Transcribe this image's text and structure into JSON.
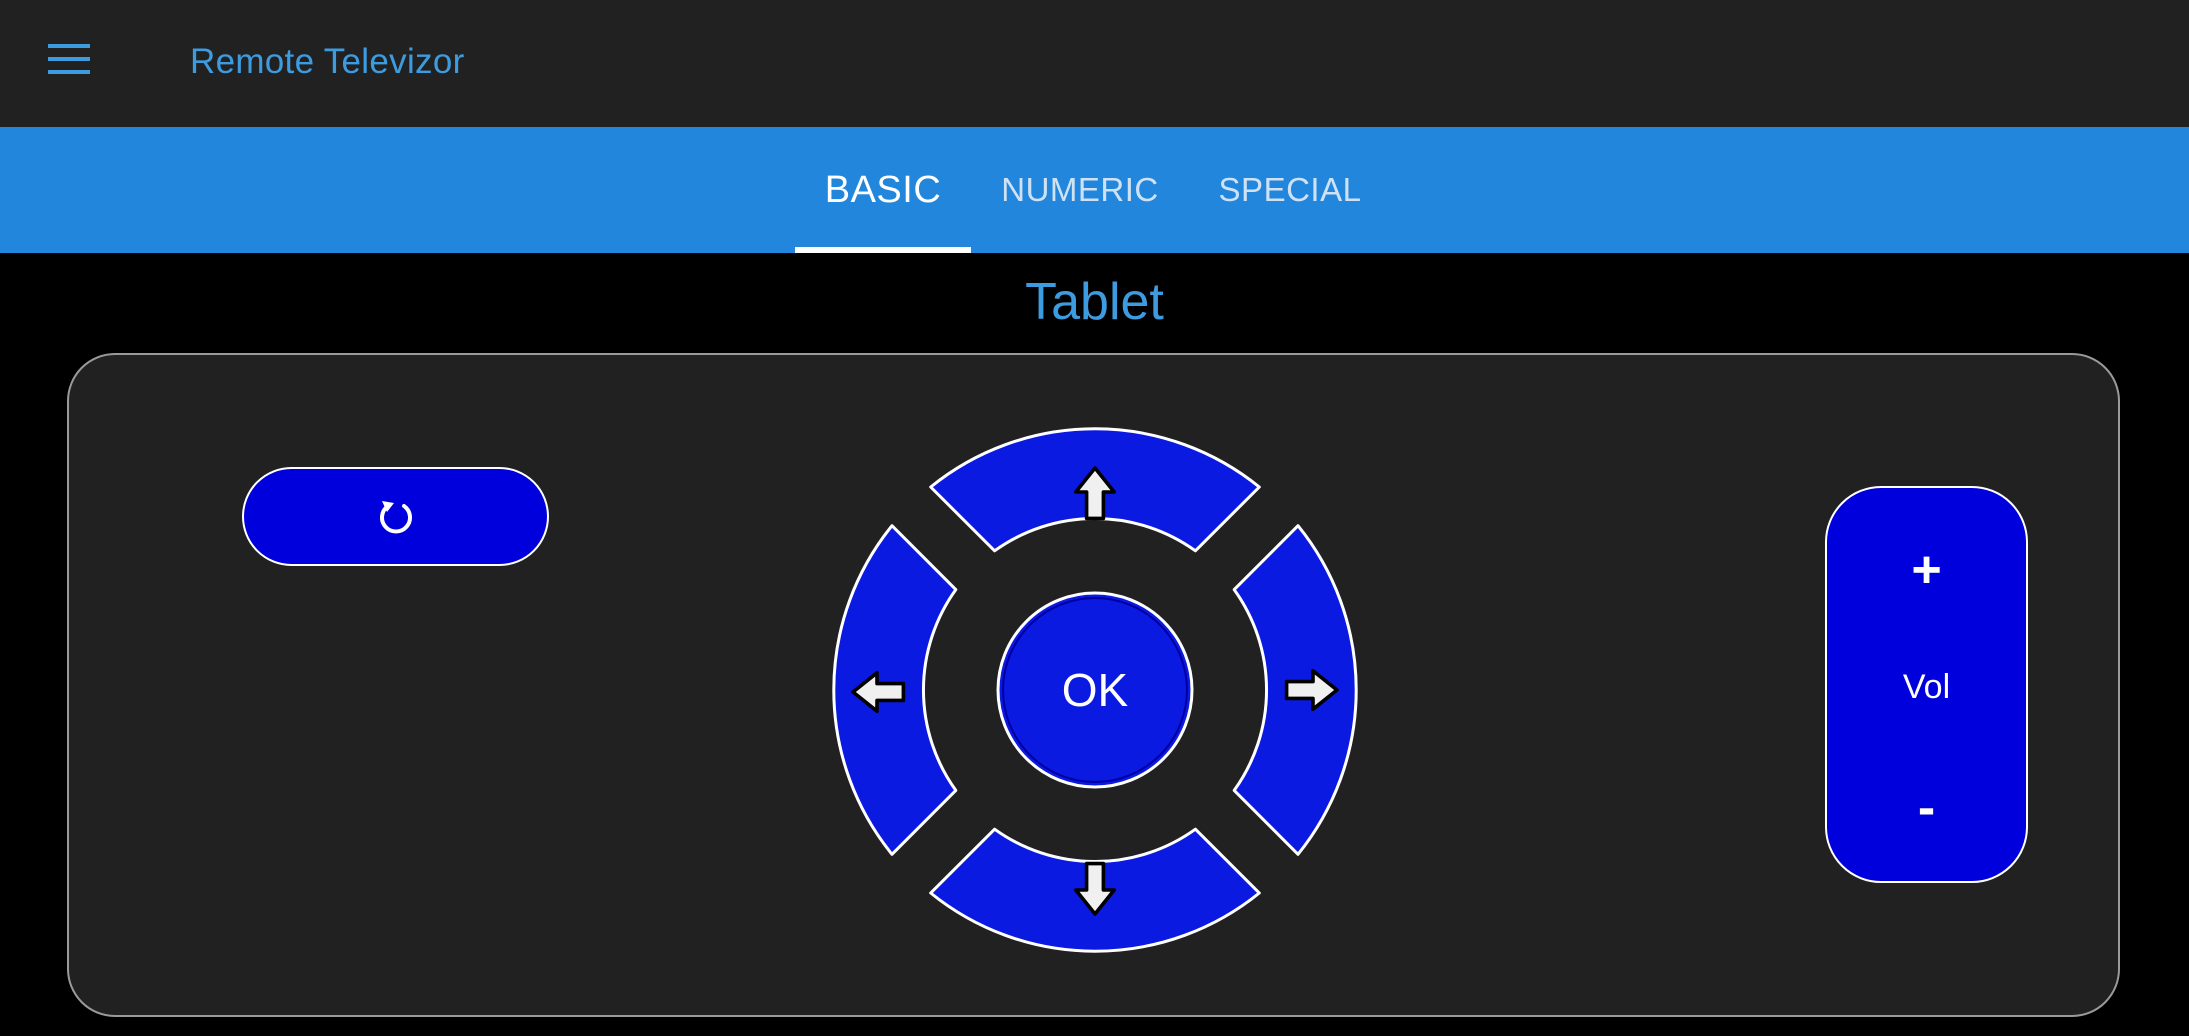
{
  "app": {
    "title": "Remote Televizor"
  },
  "tabs": [
    {
      "label": "BASIC",
      "active": true
    },
    {
      "label": "NUMERIC",
      "active": false
    },
    {
      "label": "SPECIAL",
      "active": false
    }
  ],
  "device": {
    "name": "Tablet"
  },
  "remote": {
    "back_icon": "refresh-icon",
    "dpad": {
      "ok_label": "OK",
      "up_icon": "arrow-up-icon",
      "down_icon": "arrow-down-icon",
      "left_icon": "arrow-left-icon",
      "right_icon": "arrow-right-icon"
    },
    "volume": {
      "plus": "+",
      "label": "Vol",
      "minus": "-"
    }
  },
  "colors": {
    "topbar_bg": "#212121",
    "tabbar_bg": "#2186dc",
    "accent_text": "#3d9be0",
    "button_blue": "#0000dc",
    "panel_bg": "#212121"
  }
}
